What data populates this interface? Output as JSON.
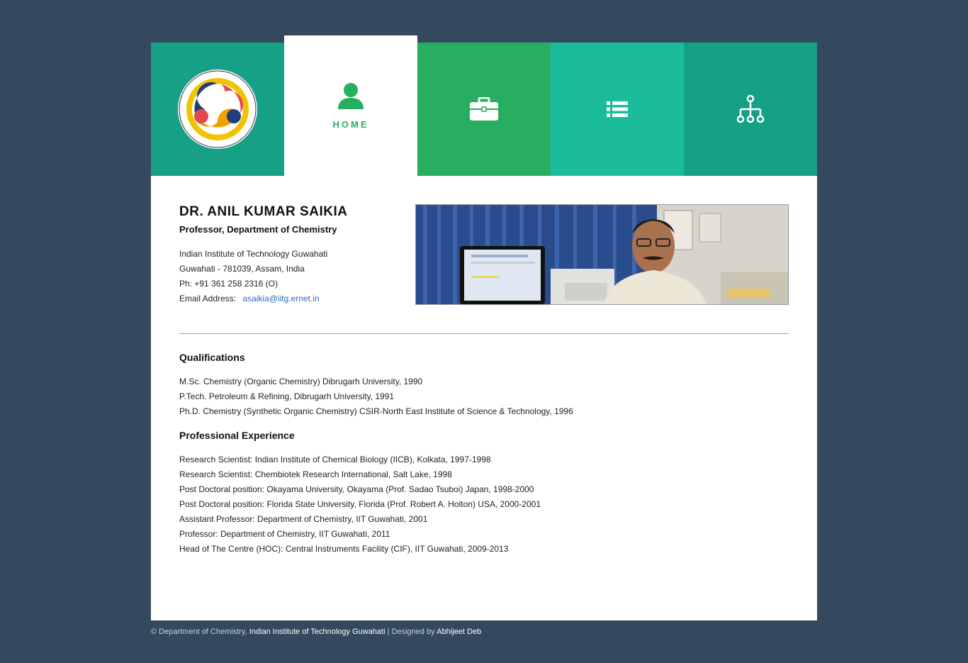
{
  "nav": {
    "home_label": "HOME",
    "icons": [
      "iitg-logo",
      "user-icon",
      "briefcase-icon",
      "list-icon",
      "sitemap-icon"
    ],
    "colors": {
      "logo_tile": "#16a085",
      "home_tile": "#ffffff",
      "work_tile": "#27ae60",
      "list_tile": "#1abc9c",
      "tree_tile": "#16a085",
      "accent": "#27ae60"
    }
  },
  "profile": {
    "name": "DR. ANIL KUMAR SAIKIA",
    "title": "Professor, Department of Chemistry",
    "address_line1": "Indian Institute of Technology Guwahati",
    "address_line2": "Guwahati - 781039, Assam, India",
    "phone": "Ph: +91 361 258 2316 (O)",
    "email_label": "Email Address:",
    "email": "asaikia@iitg.ernet.in"
  },
  "qualifications": {
    "title": "Qualifications",
    "items": [
      "M.Sc. Chemistry (Organic Chemistry) Dibrugarh University, 1990",
      "P.Tech. Petroleum & Refining, Dibrugarh University, 1991",
      "Ph.D. Chemistry (Synthetic Organic Chemistry) CSIR-North East Institute of Science & Technology, 1996"
    ]
  },
  "experience": {
    "title": "Professional Experience",
    "items": [
      "Research Scientist: Indian Institute of Chemical Biology (IICB), Kolkata, 1997-1998",
      "Research Scientist: Chembiotek Research International, Salt Lake, 1998",
      "Post Doctoral position: Okayama University, Okayama (Prof. Sadao Tsuboi) Japan, 1998-2000",
      "Post Doctoral position: Florida State University, Florida (Prof. Robert A. Holton) USA, 2000-2001",
      "Assistant Professor: Department of Chemistry, IIT Guwahati, 2001",
      "Professor: Department of Chemistry, IIT Guwahati, 2011",
      "Head of The Centre (HOC): Central Instruments Facility (CIF), IIT Guwahati, 2009-2013"
    ]
  },
  "footer": {
    "copyright": "© Department of Chemistry,",
    "institute_link": "Indian Institute of Technology Guwahati",
    "separator": "|",
    "designed_by": "Designed by",
    "designer_link": "Abhijeet Deb"
  }
}
